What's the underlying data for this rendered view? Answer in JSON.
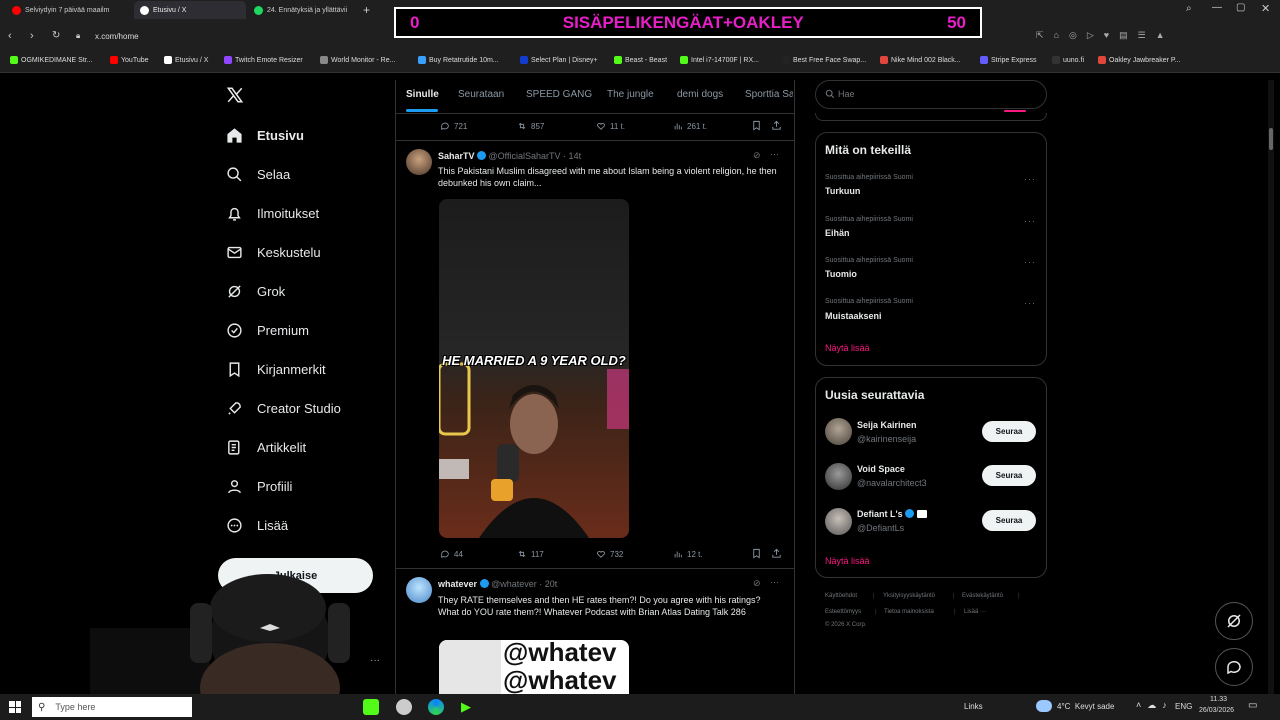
{
  "browser": {
    "tabs": [
      {
        "label": "Selviydyin 7 päivää maailm",
        "icon_color": "#ff0000"
      },
      {
        "label": "Etusivu / X",
        "icon_color": "#ffffff"
      },
      {
        "label": "24. Ennätyksiä ja yllättävii",
        "icon_color": "#1ed760"
      }
    ],
    "url": "x.com/home",
    "bookmarks": [
      {
        "label": "OGMIKEDIMANE Str...",
        "icon_color": "#53fc18"
      },
      {
        "label": "YouTube",
        "icon_color": "#ff0000"
      },
      {
        "label": "Etusivu / X",
        "icon_color": "#ffffff"
      },
      {
        "label": "Twitch Emote Resizer",
        "icon_color": "#9146ff"
      },
      {
        "label": "World Monitor - Re...",
        "icon_color": "#888888"
      },
      {
        "label": "Buy Retatrutide 10m...",
        "icon_color": "#3aa0ff"
      },
      {
        "label": "Select Plan | Disney+",
        "icon_color": "#113ccf"
      },
      {
        "label": "Beast - Beast",
        "icon_color": "#53fc18"
      },
      {
        "label": "Intel i7-14700F | RX...",
        "icon_color": "#53fc18"
      },
      {
        "label": "Best Free Face Swap...",
        "icon_color": "#222222"
      },
      {
        "label": "Nike Mind 002 Black...",
        "icon_color": "#e0463c"
      },
      {
        "label": "Stripe Express",
        "icon_color": "#635bff"
      },
      {
        "label": "uuno.fi",
        "icon_color": "#333333"
      },
      {
        "label": "Oakley Jawbreaker P...",
        "icon_color": "#e0463c"
      }
    ]
  },
  "overlay": {
    "left": "0",
    "title": "SISÄPELIKENGÄAT+OAKLEY",
    "right": "50"
  },
  "sidebar": {
    "items": [
      {
        "label": "Etusivu",
        "icon": "home-icon"
      },
      {
        "label": "Selaa",
        "icon": "search-icon"
      },
      {
        "label": "Ilmoitukset",
        "icon": "bell-icon"
      },
      {
        "label": "Keskustelu",
        "icon": "mail-icon"
      },
      {
        "label": "Grok",
        "icon": "grok-icon"
      },
      {
        "label": "Premium",
        "icon": "premium-icon"
      },
      {
        "label": "Kirjanmerkit",
        "icon": "bookmark-icon"
      },
      {
        "label": "Creator Studio",
        "icon": "rocket-icon"
      },
      {
        "label": "Artikkelit",
        "icon": "article-icon"
      },
      {
        "label": "Profiili",
        "icon": "profile-icon"
      },
      {
        "label": "Lisää",
        "icon": "more-icon"
      }
    ],
    "post_button": "Julkaise"
  },
  "feed": {
    "tabs": [
      "Sinulle",
      "Seurataan",
      "SPEED GANG",
      "The jungle",
      "demi dogs",
      "Sporttia Sa"
    ],
    "prev_stats": {
      "replies": "721",
      "reposts": "857",
      "likes": "11 t.",
      "views": "261 t."
    },
    "posts": [
      {
        "name": "SaharTV",
        "handle": "@OfficialSaharTV",
        "time": "· 14t",
        "text": "This Pakistani Muslim disagreed with me about Islam being a violent religion, he then debunked his own claim...",
        "media_caption": "HE MARRIED A 9 YEAR OLD?",
        "stats": {
          "replies": "44",
          "reposts": "117",
          "likes": "732",
          "views": "12 t."
        }
      },
      {
        "name": "whatever",
        "handle": "@whatever",
        "time": "· 20t",
        "text": "They RATE themselves and then HE rates them?! Do you agree with his ratings? What do YOU rate them?! Whatever Podcast with Brian Atlas Dating Talk 286",
        "media_text": "@whatev"
      }
    ]
  },
  "right": {
    "search_placeholder": "Hae",
    "trends_title": "Mitä on tekeillä",
    "trends": [
      {
        "context": "Suosittua aihepiirissä Suomi",
        "name": "Turkuun"
      },
      {
        "context": "Suosittua aihepiirissä Suomi",
        "name": "Eihän"
      },
      {
        "context": "Suosittua aihepiirissä Suomi",
        "name": "Tuomio"
      },
      {
        "context": "Suosittua aihepiirissä Suomi",
        "name": "Muistaakseni"
      }
    ],
    "show_more": "Näytä lisää",
    "follow_title": "Uusia seurattavia",
    "follows": [
      {
        "name": "Seija Kairinen",
        "handle": "@kairinenseija",
        "button": "Seuraa"
      },
      {
        "name": "Void Space",
        "handle": "@navalarchitect3",
        "button": "Seuraa"
      },
      {
        "name": "Defiant L's",
        "handle": "@DefiantLs",
        "button": "Seuraa"
      }
    ],
    "show_more2": "Näytä lisää",
    "footer": [
      "Käyttöehdot",
      "Yksityisyyskäytäntö",
      "Evästekäytäntö",
      "Esteettömyys",
      "Tietoa mainoksista",
      "Lisää ···",
      "© 2026 X Corp."
    ]
  },
  "taskbar": {
    "search_placeholder": "Type here",
    "links": "Links",
    "weather": "4°C  Kevyt sade",
    "lang": "ENG",
    "time": "11.33",
    "date": "26/03/2026"
  },
  "colors": {
    "accent": "#1d9bf0",
    "link": "#f91880",
    "overlay": "#e81ec8"
  }
}
